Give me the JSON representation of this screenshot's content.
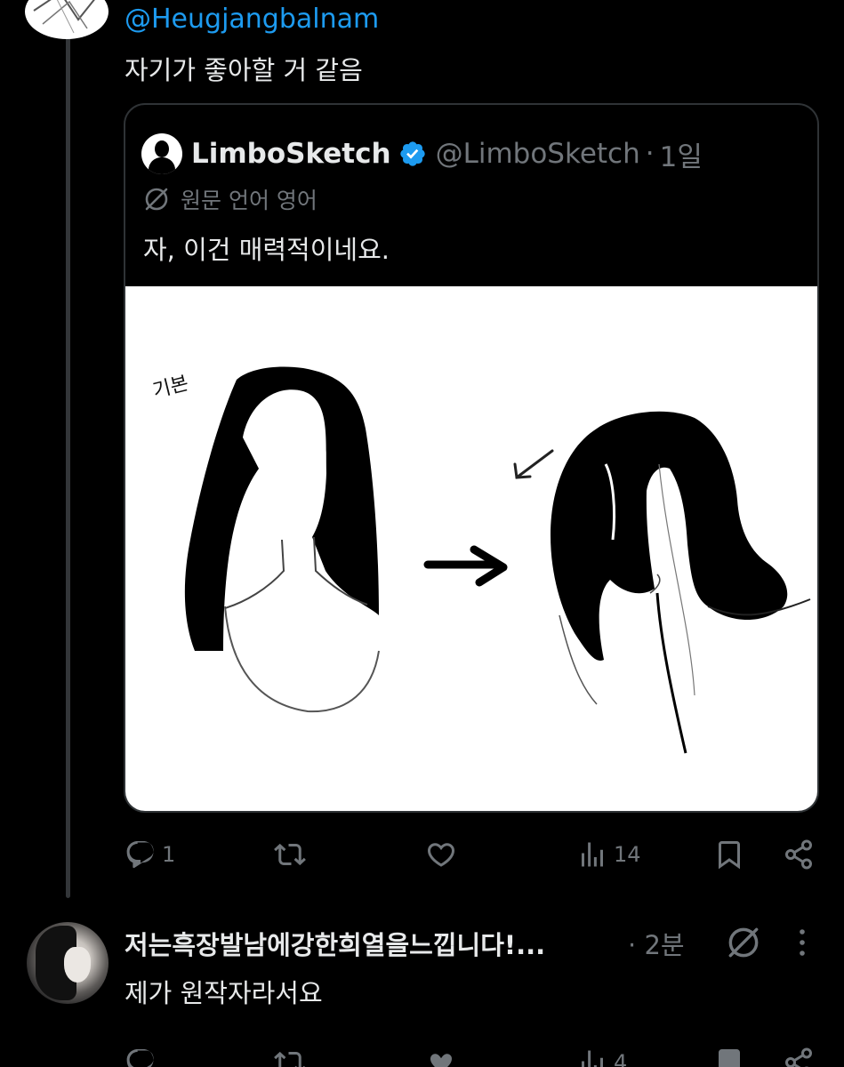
{
  "top_tweet": {
    "mention": "@Heugjangbalnam",
    "text": "자기가 좋아할 거 같음"
  },
  "quote": {
    "name": "LimboSketch",
    "verified": true,
    "handle": "@LimboSketch",
    "separator": "·",
    "time": "1일",
    "translate_label": "원문 언어 영어",
    "text": "자, 이건 매력적이네요.",
    "image_label": "기본"
  },
  "actions_1": {
    "reply_count": "1",
    "retweet_count": "",
    "like_count": "",
    "views_count": "14"
  },
  "reply": {
    "name": "저는흑장발남에강한희열을느낍니다!...",
    "separator": "·",
    "time": "2분",
    "text": "제가 원작자라서요"
  },
  "actions_2": {
    "reply_count": "",
    "retweet_count": "",
    "like_count": "",
    "views_count": "4"
  },
  "colors": {
    "background": "#000000",
    "primary_text": "#e7e9ea",
    "secondary_text": "#71767b",
    "accent": "#1d9bf0",
    "border": "#2f3336"
  },
  "icons": [
    "reply-icon",
    "retweet-icon",
    "like-icon",
    "views-icon",
    "bookmark-icon",
    "share-icon",
    "translate-icon",
    "more-icon",
    "verified-icon"
  ]
}
